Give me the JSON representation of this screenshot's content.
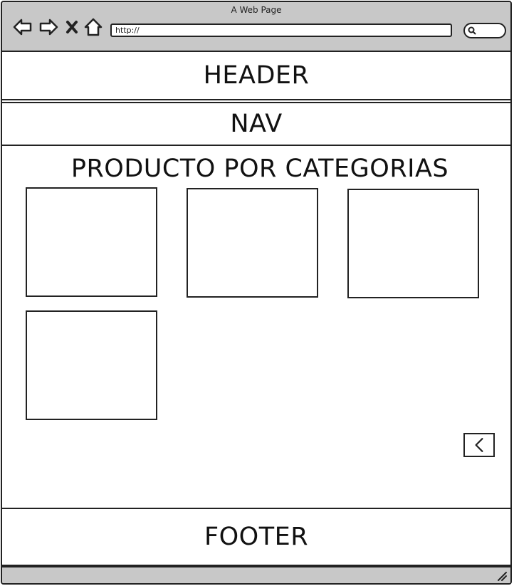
{
  "window": {
    "title": "A Web Page"
  },
  "toolbar": {
    "back_icon": "arrow-left-icon",
    "forward_icon": "arrow-right-icon",
    "stop_icon": "close-icon",
    "home_icon": "home-icon"
  },
  "address_bar": {
    "value": "http://"
  },
  "search": {
    "icon": "search-icon"
  },
  "header": {
    "label": "HEADER"
  },
  "nav": {
    "label": "NAV"
  },
  "main": {
    "title": "PRODUCTO POR CATEGORIAS",
    "products": [
      "",
      "",
      "",
      ""
    ],
    "pager_icon": "chevron-left-icon"
  },
  "footer": {
    "label": "FOOTER"
  },
  "colors": {
    "chrome": "#c8c8c8",
    "stroke": "#222222",
    "background": "#ffffff"
  }
}
